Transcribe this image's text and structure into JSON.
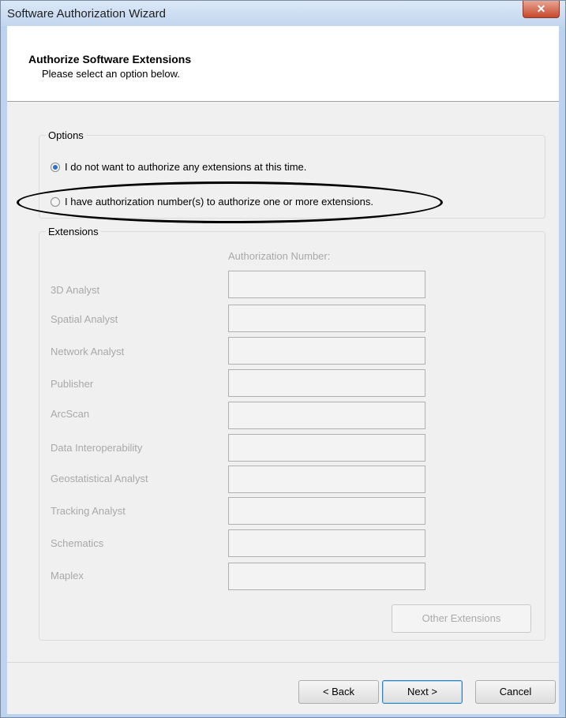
{
  "window": {
    "title": "Software Authorization Wizard",
    "close_symbol": "✕"
  },
  "header": {
    "title": "Authorize Software Extensions",
    "subtitle": "Please select an option below."
  },
  "options": {
    "group_label": "Options",
    "items": [
      {
        "label": "I do not want to authorize any extensions at this time.",
        "checked": true
      },
      {
        "label": "I have authorization number(s) to authorize one or more extensions.",
        "checked": false
      }
    ]
  },
  "extensions": {
    "group_label": "Extensions",
    "column_header": "Authorization Number:",
    "items": [
      {
        "name": "3D Analyst",
        "value": ""
      },
      {
        "name": "Spatial Analyst",
        "value": ""
      },
      {
        "name": "Network Analyst",
        "value": ""
      },
      {
        "name": "Publisher",
        "value": ""
      },
      {
        "name": "ArcScan",
        "value": ""
      },
      {
        "name": "Data Interoperability",
        "value": ""
      },
      {
        "name": "Geostatistical Analyst",
        "value": ""
      },
      {
        "name": "Tracking Analyst",
        "value": ""
      },
      {
        "name": "Schematics",
        "value": ""
      },
      {
        "name": "Maplex",
        "value": ""
      }
    ],
    "other_button": "Other Extensions"
  },
  "footer": {
    "back": "< Back",
    "next": "Next >",
    "cancel": "Cancel"
  }
}
